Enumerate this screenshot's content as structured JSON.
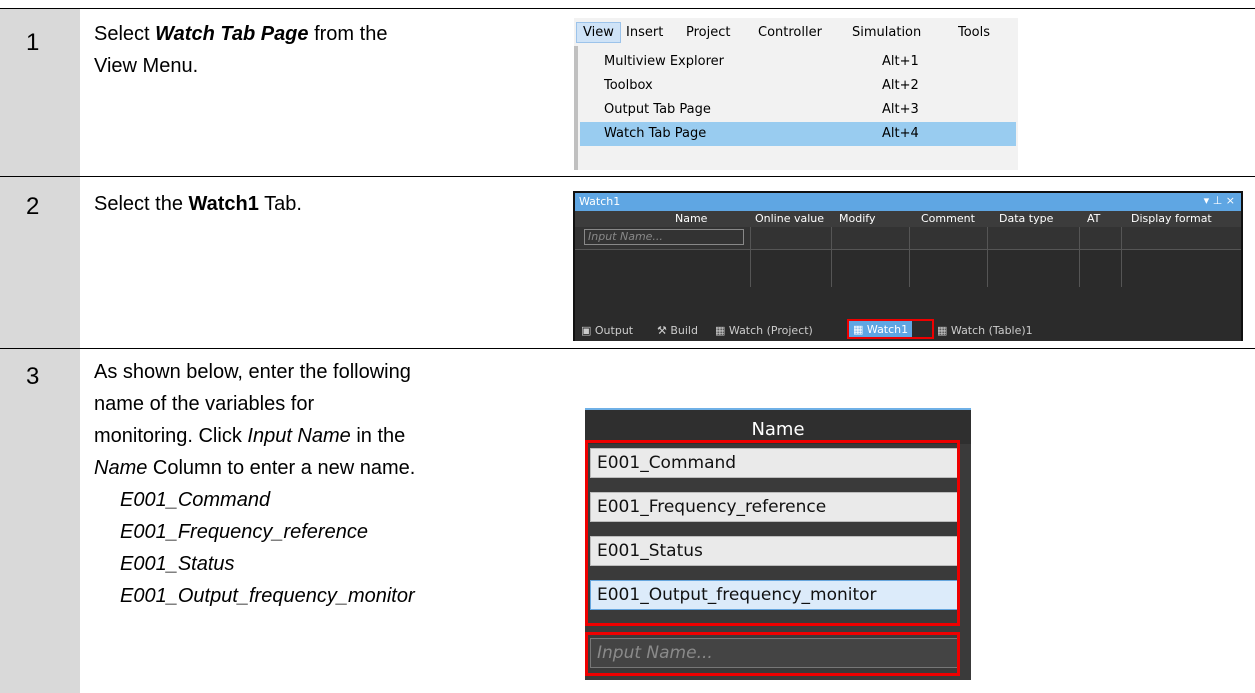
{
  "steps": [
    {
      "number": "1",
      "parts": [
        "Select ",
        "Watch Tab Page",
        " from the",
        "View Menu."
      ]
    },
    {
      "number": "2",
      "parts": [
        "Select the ",
        "Watch1",
        " Tab."
      ]
    },
    {
      "number": "3",
      "lines": [
        "As shown below, enter the following",
        "name of the variables for"
      ],
      "line3": [
        "monitoring. Click ",
        "Input Name",
        " in the"
      ],
      "line4": [
        "Name",
        " Column to enter a new name."
      ],
      "variables": [
        "E001_Command",
        "E001_Frequency_reference",
        "E001_Status",
        "E001_Output_frequency_monitor"
      ]
    }
  ],
  "view_menu": {
    "bar": [
      "View",
      "Insert",
      "Project",
      "Controller",
      "Simulation",
      "Tools"
    ],
    "items": [
      {
        "label": "Multiview Explorer",
        "key": "Alt+1"
      },
      {
        "label": "Toolbox",
        "key": "Alt+2"
      },
      {
        "label": "Output Tab Page",
        "key": "Alt+3"
      },
      {
        "label": "Watch Tab Page",
        "key": "Alt+4"
      }
    ]
  },
  "watch_panel": {
    "title": "Watch1",
    "controls": "▾ ⊥ ×",
    "columns": [
      "Name",
      "Online value",
      "Modify",
      "Comment",
      "Data type",
      "AT",
      "Display format"
    ],
    "input_placeholder": "Input Name...",
    "tabs": [
      "Output",
      "Build",
      "Watch (Project)",
      "Watch1",
      "Watch (Table)1"
    ]
  },
  "name_column": {
    "header": "Name",
    "values": [
      "E001_Command",
      "E001_Frequency_reference",
      "E001_Status",
      "E001_Output_frequency_monitor"
    ],
    "placeholder": "Input Name..."
  }
}
